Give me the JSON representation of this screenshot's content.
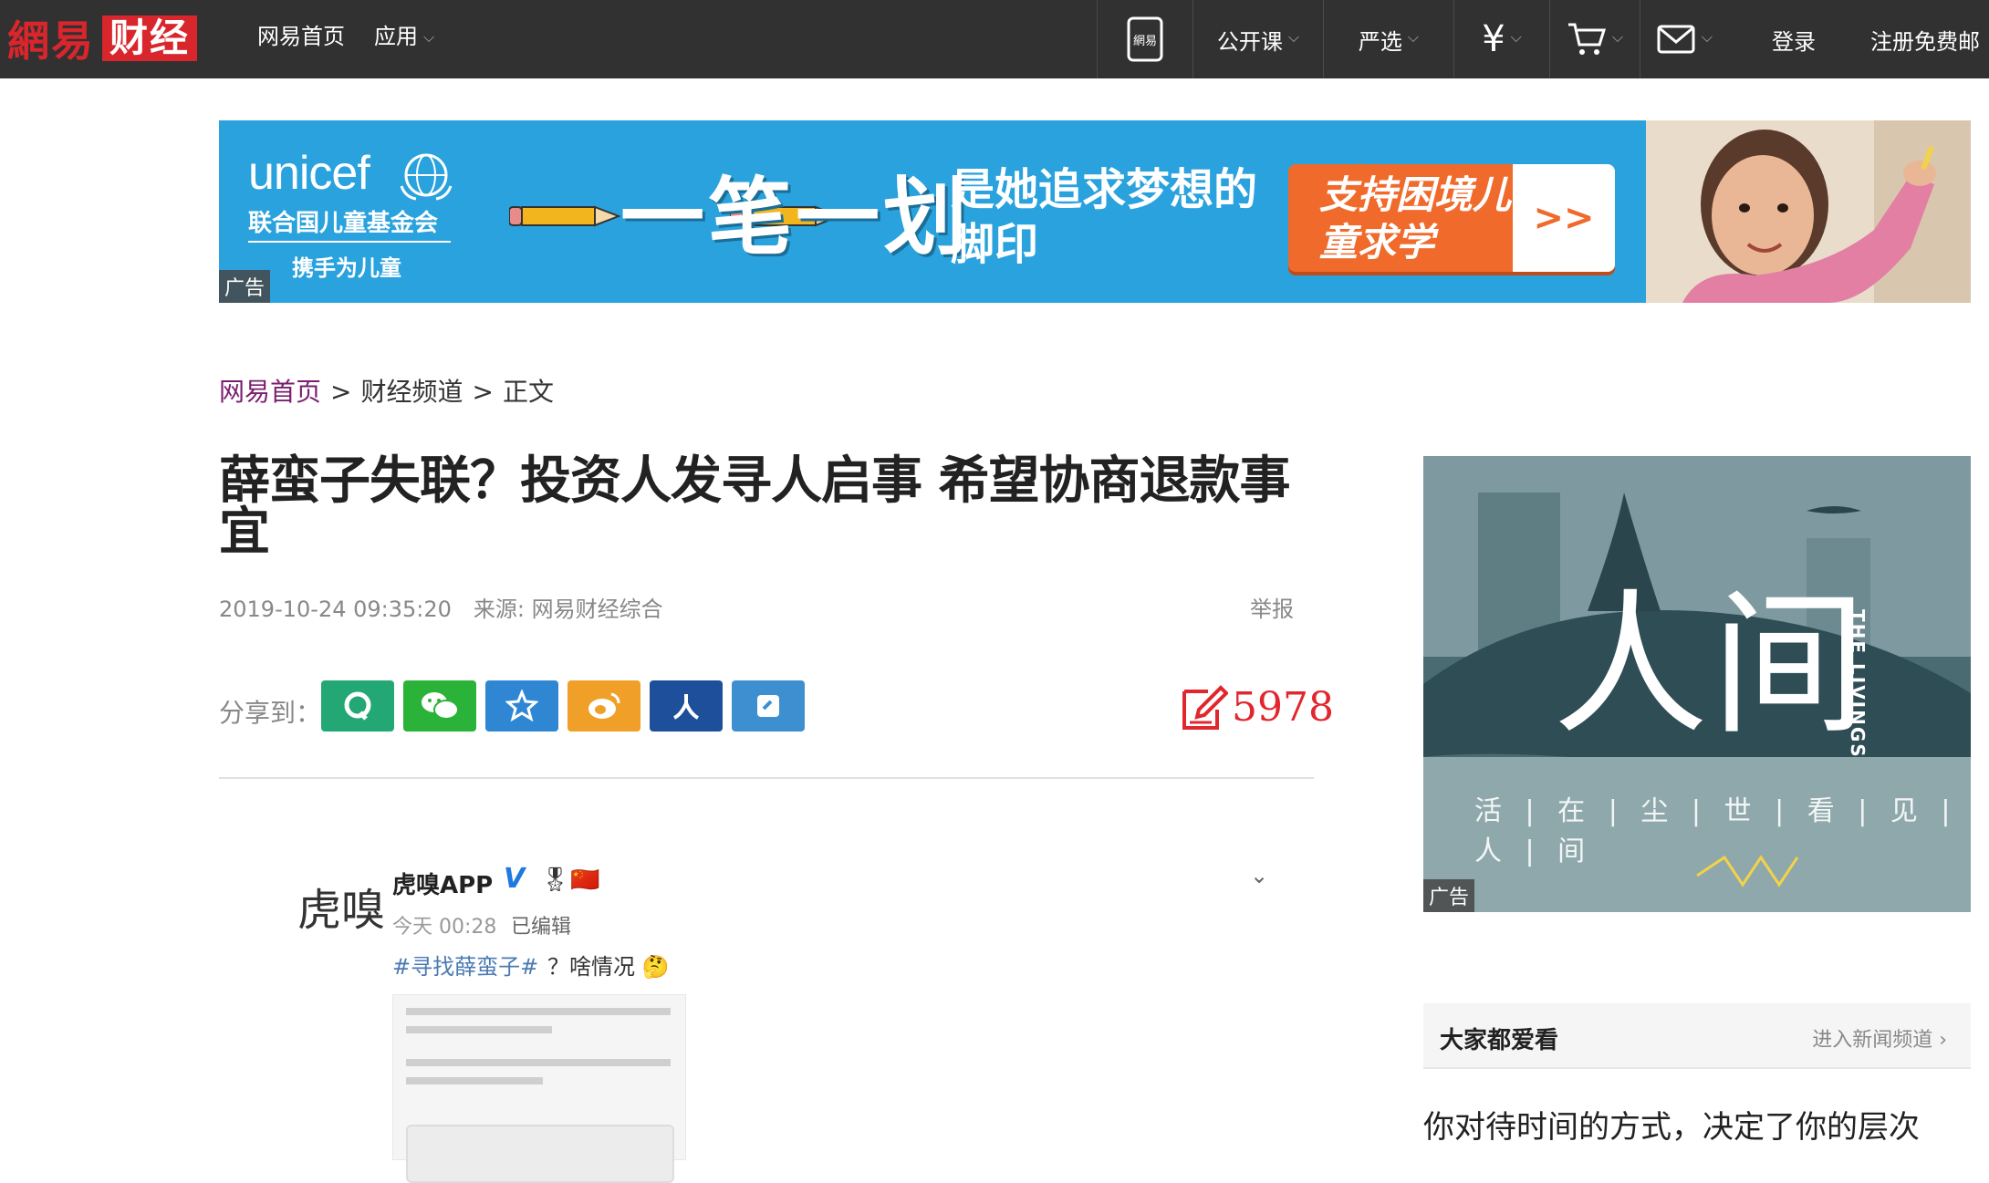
{
  "topbar": {
    "logo_main": "網易",
    "logo_channel": "财经",
    "nav_left": [
      "网易首页",
      "应用"
    ],
    "nav_right": {
      "open_course": "公开课",
      "yanxuan": "严选",
      "login": "登录",
      "register": "注册免费邮"
    }
  },
  "banner": {
    "ad_label": "广告",
    "org": "unicef",
    "org_cn": "联合国儿童基金会",
    "org_tagline": "携手为儿童",
    "slogan_big": "一笔一划",
    "slogan_small": "是她追求梦想的脚印",
    "cta": "支持困境儿童求学",
    "cta_arrow": ">>"
  },
  "breadcrumb": {
    "home": "网易首页",
    "channel": "财经频道",
    "current": "正文",
    "sep": ">"
  },
  "article": {
    "title": "薛蛮子失联？投资人发寻人启事 希望协商退款事宜",
    "datetime": "2019-10-24 09:35:20",
    "source": "来源: 网易财经综合",
    "report": "举报",
    "share_label": "分享到：",
    "share_targets": [
      "qq-zone",
      "wechat",
      "qq-friends",
      "weibo",
      "renren",
      "youdao"
    ],
    "comment_count": "5978"
  },
  "embedded_post": {
    "avatar_text": "虎嗅",
    "author": "虎嗅APP",
    "verified_mark": "V",
    "time": "今天 00:28",
    "edited": "已编辑",
    "hashtag": "#寻找薛蛮子#",
    "text": "？啥情况"
  },
  "side_ad": {
    "ad_label": "广告",
    "title": "人间",
    "title_en": "THE LIVINGS",
    "tagline": "活 | 在 | 尘 | 世 | 看 | 见 | 人 | 间"
  },
  "hot": {
    "title": "大家都爱看",
    "more": "进入新闻频道 ›",
    "first_item": "你对待时间的方式，决定了你的层次"
  },
  "colors": {
    "topbar_bg": "#313131",
    "brand_red": "#d8262c",
    "banner_blue": "#29a2dd",
    "cta_orange": "#f06a2c",
    "comment_red": "#e2262d"
  }
}
